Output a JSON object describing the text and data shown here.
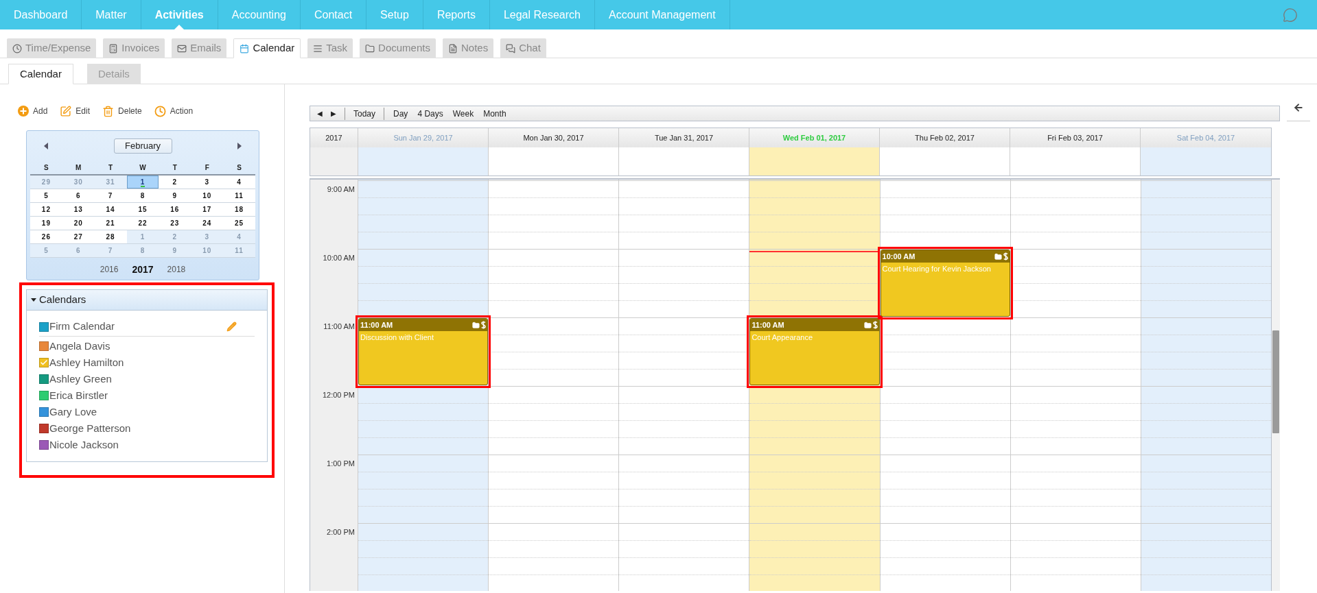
{
  "nav": {
    "items": [
      {
        "label": "Dashboard",
        "selected": false
      },
      {
        "label": "Matter",
        "selected": false
      },
      {
        "label": "Activities",
        "selected": true
      },
      {
        "label": "Accounting",
        "selected": false
      },
      {
        "label": "Contact",
        "selected": false
      },
      {
        "label": "Setup",
        "selected": false
      },
      {
        "label": "Reports",
        "selected": false
      },
      {
        "label": "Legal Research",
        "selected": false
      },
      {
        "label": "Account Management",
        "selected": false
      }
    ]
  },
  "module_tabs": [
    {
      "label": "Time/Expense",
      "selected": false
    },
    {
      "label": "Invoices",
      "selected": false
    },
    {
      "label": "Emails",
      "selected": false
    },
    {
      "label": "Calendar",
      "selected": true
    },
    {
      "label": "Task",
      "selected": false
    },
    {
      "label": "Documents",
      "selected": false
    },
    {
      "label": "Notes",
      "selected": false
    },
    {
      "label": "Chat",
      "selected": false
    }
  ],
  "view_tabs": [
    {
      "label": "Calendar",
      "selected": true
    },
    {
      "label": "Details",
      "selected": false
    }
  ],
  "actions": [
    "Add",
    "Edit",
    "Delete",
    "Action"
  ],
  "mini_calendar": {
    "month": "February",
    "weekdays": [
      "S",
      "M",
      "T",
      "W",
      "T",
      "F",
      "S"
    ],
    "weeks": [
      {
        "days": [
          {
            "label": "29",
            "in_month": false,
            "selected": false
          },
          {
            "label": "30",
            "in_month": false,
            "selected": false
          },
          {
            "label": "31",
            "in_month": false,
            "selected": false
          },
          {
            "label": "1",
            "in_month": true,
            "selected": true
          },
          {
            "label": "2",
            "in_month": true,
            "selected": false
          },
          {
            "label": "3",
            "in_month": true,
            "selected": false
          },
          {
            "label": "4",
            "in_month": true,
            "selected": false
          }
        ]
      },
      {
        "days": [
          {
            "label": "5",
            "in_month": true,
            "selected": false
          },
          {
            "label": "6",
            "in_month": true,
            "selected": false
          },
          {
            "label": "7",
            "in_month": true,
            "selected": false
          },
          {
            "label": "8",
            "in_month": true,
            "selected": false
          },
          {
            "label": "9",
            "in_month": true,
            "selected": false
          },
          {
            "label": "10",
            "in_month": true,
            "selected": false
          },
          {
            "label": "11",
            "in_month": true,
            "selected": false
          }
        ]
      },
      {
        "days": [
          {
            "label": "12",
            "in_month": true,
            "selected": false
          },
          {
            "label": "13",
            "in_month": true,
            "selected": false
          },
          {
            "label": "14",
            "in_month": true,
            "selected": false
          },
          {
            "label": "15",
            "in_month": true,
            "selected": false
          },
          {
            "label": "16",
            "in_month": true,
            "selected": false
          },
          {
            "label": "17",
            "in_month": true,
            "selected": false
          },
          {
            "label": "18",
            "in_month": true,
            "selected": false
          }
        ]
      },
      {
        "days": [
          {
            "label": "19",
            "in_month": true,
            "selected": false
          },
          {
            "label": "20",
            "in_month": true,
            "selected": false
          },
          {
            "label": "21",
            "in_month": true,
            "selected": false
          },
          {
            "label": "22",
            "in_month": true,
            "selected": false
          },
          {
            "label": "23",
            "in_month": true,
            "selected": false
          },
          {
            "label": "24",
            "in_month": true,
            "selected": false
          },
          {
            "label": "25",
            "in_month": true,
            "selected": false
          }
        ]
      },
      {
        "days": [
          {
            "label": "26",
            "in_month": true,
            "selected": false
          },
          {
            "label": "27",
            "in_month": true,
            "selected": false
          },
          {
            "label": "28",
            "in_month": true,
            "selected": false
          },
          {
            "label": "1",
            "in_month": false,
            "selected": false
          },
          {
            "label": "2",
            "in_month": false,
            "selected": false
          },
          {
            "label": "3",
            "in_month": false,
            "selected": false
          },
          {
            "label": "4",
            "in_month": false,
            "selected": false
          }
        ]
      },
      {
        "days": [
          {
            "label": "5",
            "in_month": false,
            "selected": false
          },
          {
            "label": "6",
            "in_month": false,
            "selected": false
          },
          {
            "label": "7",
            "in_month": false,
            "selected": false
          },
          {
            "label": "8",
            "in_month": false,
            "selected": false
          },
          {
            "label": "9",
            "in_month": false,
            "selected": false
          },
          {
            "label": "10",
            "in_month": false,
            "selected": false
          },
          {
            "label": "11",
            "in_month": false,
            "selected": false
          }
        ]
      }
    ],
    "years": [
      {
        "label": "2016",
        "selected": false
      },
      {
        "label": "2017",
        "selected": true
      },
      {
        "label": "2018",
        "selected": false
      }
    ]
  },
  "calendars": {
    "title": "Calendars",
    "expanded": true,
    "highlighted": true,
    "items": [
      {
        "kind": "firm",
        "name": "Firm Calendar",
        "color": "#1ba1c8",
        "checked": false
      },
      {
        "kind": "user",
        "name": "Angela Davis",
        "color": "#e8873a",
        "checked": false
      },
      {
        "kind": "user",
        "name": "Ashley Hamilton",
        "color": "#f0c020",
        "checked": true
      },
      {
        "kind": "user",
        "name": "Ashley Green",
        "color": "#159a80",
        "checked": false
      },
      {
        "kind": "user",
        "name": "Erica Birstler",
        "color": "#2ecc71",
        "checked": false
      },
      {
        "kind": "user",
        "name": "Gary Love",
        "color": "#3493db",
        "checked": false
      },
      {
        "kind": "user",
        "name": "George Patterson",
        "color": "#c0392b",
        "checked": false
      },
      {
        "kind": "user",
        "name": "Nicole Jackson",
        "color": "#9b59b6",
        "checked": false
      }
    ]
  },
  "scheduler": {
    "nav_buttons": [
      "◀",
      "▶"
    ],
    "today_button": "Today",
    "views": [
      "Day",
      "4 Days",
      "Week",
      "Month"
    ],
    "year": "2017",
    "hours": [
      "9:00 AM",
      "10:00 AM",
      "11:00 AM",
      "12:00 PM",
      "1:00 PM",
      "2:00 PM"
    ],
    "days": [
      {
        "label": "Sun Jan 29, 2017",
        "weekend": true,
        "today": false,
        "events": [
          {
            "time": "11:00 AM",
            "title": "Discussion with Client",
            "highlighted": true
          }
        ]
      },
      {
        "label": "Mon Jan 30, 2017",
        "weekend": false,
        "today": false
      },
      {
        "label": "Tue Jan 31, 2017",
        "weekend": false,
        "today": false
      },
      {
        "label": "Wed Feb 01, 2017",
        "weekend": false,
        "today": true,
        "events": [
          {
            "time": "11:00 AM",
            "title": "Court Appearance",
            "highlighted": true
          }
        ]
      },
      {
        "label": "Thu Feb 02, 2017",
        "weekend": false,
        "today": false,
        "events": [
          {
            "time": "10:00 AM",
            "title": "Court Hearing for Kevin Jackson",
            "highlighted": true
          }
        ]
      },
      {
        "label": "Fri Feb 03, 2017",
        "weekend": false,
        "today": false
      },
      {
        "label": "Sat Feb 04, 2017",
        "weekend": true,
        "today": false
      }
    ]
  }
}
